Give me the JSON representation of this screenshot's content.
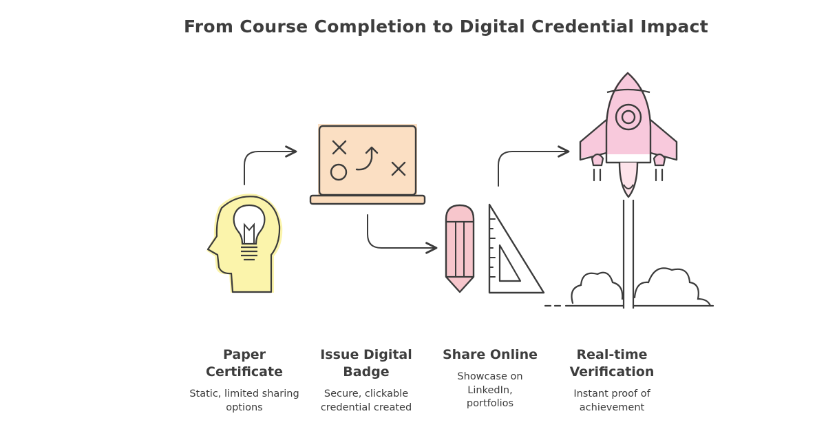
{
  "title": "From Course Completion to Digital Credential Impact",
  "steps": [
    {
      "title": "Paper Certificate",
      "description": "Static, limited sharing options",
      "icon": "lightbulb-head-icon"
    },
    {
      "title": "Issue Digital Badge",
      "description": "Secure, clickable credential created",
      "icon": "strategy-board-icon"
    },
    {
      "title": "Share Online",
      "description": "Showcase on LinkedIn, portfolios",
      "icon": "pencil-ruler-icon"
    },
    {
      "title": "Real-time Verification",
      "description": "Instant proof of achievement",
      "icon": "rocket-launch-icon"
    }
  ],
  "colors": {
    "yellow_fill": "#fbf3a6",
    "orange_fill": "#fbdcbd",
    "pink_fill": "#f7c6cc",
    "rocket_fill": "#f8c9dc",
    "stroke": "#3b3b3b"
  }
}
